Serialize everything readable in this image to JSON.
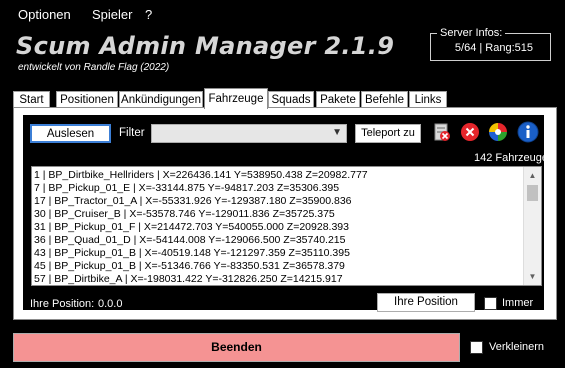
{
  "menu": {
    "optionen": "Optionen",
    "spieler": "Spieler",
    "help": "?"
  },
  "header": {
    "title": "Scum Admin Manager 2.1.9",
    "subtitle": "entwickelt von Randle Flag (2022)"
  },
  "server": {
    "legend": "Server Infos:",
    "value": "5/64 | Rang:515"
  },
  "tabs": [
    {
      "label": "Start"
    },
    {
      "label": "Positionen"
    },
    {
      "label": "Ankündigungen"
    },
    {
      "label": "Fahrzeuge"
    },
    {
      "label": "Squads"
    },
    {
      "label": "Pakete"
    },
    {
      "label": "Befehle"
    },
    {
      "label": "Links"
    }
  ],
  "active_tab": "Fahrzeuge",
  "vehicles": {
    "read_button": "Auslesen",
    "filter_label": "Filter",
    "filter_value": "",
    "teleport_button": "Teleport zu",
    "count": "142  Fahrzeuge",
    "rows": [
      "1 | BP_Dirtbike_Hellriders | X=226436.141 Y=538950.438 Z=20982.777",
      "7 | BP_Pickup_01_E | X=-33144.875 Y=-94817.203 Z=35306.395",
      "17 | BP_Tractor_01_A | X=-55331.926 Y=-129387.180 Z=35900.836",
      "30 | BP_Cruiser_B | X=-53578.746 Y=-129011.836 Z=35725.375",
      "31 | BP_Pickup_01_F | X=214472.703 Y=540055.000 Z=20928.393",
      "36 | BP_Quad_01_D | X=-54144.008 Y=-129066.500 Z=35740.215",
      "43 | BP_Pickup_01_B | X=-40519.148 Y=-121297.359 Z=35110.395",
      "45 | BP_Pickup_01_B | X=-51346.766 Y=-83350.531 Z=36578.379",
      "57 | BP_Dirtbike_A | X=-198031.422 Y=-312826.250 Z=14215.917"
    ],
    "position_label": "Ihre Position:",
    "position_value": "0.0.0",
    "position_button": "Ihre Position",
    "immer_label": "Immer"
  },
  "footer": {
    "beenden_button": "Beenden",
    "verkleinern_label": "Verkleinern"
  },
  "icons": [
    "delete-vehicle-icon",
    "close-icon",
    "color-wheel-icon",
    "info-icon"
  ],
  "colors": {
    "beenden_bg": "#f59393",
    "accent_border": "#3c7fd6",
    "info_blue": "#1a5fc7",
    "close_red": "#e5252b"
  }
}
